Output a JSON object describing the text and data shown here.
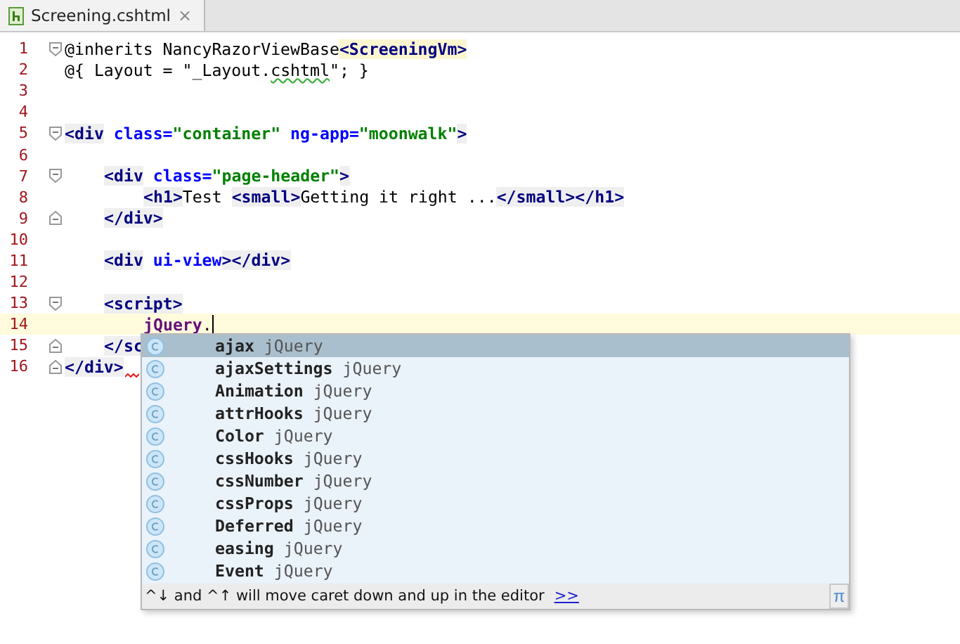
{
  "tabs": [
    {
      "label": "Screening.cshtml",
      "selected": true,
      "close": "×"
    }
  ],
  "lines": [
    {
      "number": "1",
      "kind": "top",
      "fold_start": true,
      "fold_end": false,
      "current": false,
      "error": false,
      "tokens": [
        {
          "kind": "plain",
          "text": "@inherits NancyRazorViewBase"
        },
        {
          "kind": "type",
          "text": "<ScreeningVm>"
        }
      ]
    },
    {
      "number": "2",
      "kind": "top",
      "fold_start": false,
      "fold_end": false,
      "current": false,
      "error": false,
      "tokens": [
        {
          "kind": "plain",
          "text": "@{ Layout = \"_Layout."
        },
        {
          "kind": "warn",
          "text": "cshtml"
        },
        {
          "kind": "plain",
          "text": "\"; }"
        }
      ]
    },
    {
      "number": "3",
      "fold_start": false,
      "fold_end": false,
      "current": false,
      "error": false
    },
    {
      "number": "4",
      "fold_start": false,
      "fold_end": false,
      "current": false,
      "error": false
    },
    {
      "number": "5",
      "kind": "top",
      "fold_start": true,
      "fold_end": false,
      "current": false,
      "error": false,
      "tokens": [
        {
          "kind": "tag",
          "text": "<div"
        },
        {
          "kind": "attr",
          "text": " class="
        },
        {
          "kind": "str",
          "text": "\"container\""
        },
        {
          "kind": "attr",
          "text": " ng-app="
        },
        {
          "kind": "str",
          "text": "\"moonwalk\""
        },
        {
          "kind": "tag",
          "text": ">"
        }
      ]
    },
    {
      "number": "6",
      "fold_start": false,
      "fold_end": false,
      "current": false,
      "error": false
    },
    {
      "number": "7",
      "kind": "inner",
      "fold_start": true,
      "fold_end": false,
      "current": false,
      "error": false,
      "tokens": [
        {
          "kind": "tag",
          "text": "<div"
        },
        {
          "kind": "attr",
          "text": " class="
        },
        {
          "kind": "str",
          "text": "\"page-header\""
        },
        {
          "kind": "tag",
          "text": ">"
        }
      ]
    },
    {
      "number": "8",
      "kind": "innermost",
      "fold_start": false,
      "fold_end": false,
      "current": false,
      "error": false,
      "tokens": [
        {
          "kind": "tag",
          "text": "<h1>"
        },
        {
          "kind": "plain",
          "text": "Test "
        },
        {
          "kind": "tag",
          "text": "<small>"
        },
        {
          "kind": "plain",
          "text": "Getting it right ..."
        },
        {
          "kind": "tag",
          "text": "</small></h1>"
        }
      ]
    },
    {
      "number": "9",
      "kind": "inner",
      "fold_start": false,
      "fold_end": true,
      "current": false,
      "error": false,
      "tokens": [
        {
          "kind": "tag",
          "text": "</div>"
        }
      ]
    },
    {
      "number": "10",
      "fold_start": false,
      "fold_end": false,
      "current": false,
      "error": false
    },
    {
      "number": "11",
      "kind": "inner",
      "fold_start": false,
      "fold_end": false,
      "current": false,
      "error": false,
      "tokens": [
        {
          "kind": "tag",
          "text": "<div"
        },
        {
          "kind": "attr",
          "text": " ui-view"
        },
        {
          "kind": "tag",
          "text": "></div>"
        }
      ]
    },
    {
      "number": "12",
      "fold_start": false,
      "fold_end": false,
      "current": false,
      "error": false
    },
    {
      "number": "13",
      "kind": "inner",
      "fold_start": true,
      "fold_end": false,
      "current": false,
      "error": false,
      "tokens": [
        {
          "kind": "tag",
          "text": "<script>"
        }
      ]
    },
    {
      "number": "14",
      "kind": "innermost",
      "fold_start": false,
      "fold_end": false,
      "current": true,
      "error": false,
      "tokens": [
        {
          "kind": "ident",
          "text": "jQuery"
        },
        {
          "kind": "plain",
          "text": "."
        }
      ]
    },
    {
      "number": "15",
      "kind": "inner",
      "fold_start": false,
      "fold_end": true,
      "current": false,
      "error": false,
      "tokens": [
        {
          "kind": "tag",
          "text": "</sc"
        }
      ]
    },
    {
      "number": "16",
      "kind": "top",
      "fold_start": false,
      "fold_end": true,
      "current": false,
      "error": true,
      "tokens": [
        {
          "kind": "tag",
          "text": "</div>"
        }
      ]
    }
  ],
  "completion": {
    "items": [
      {
        "name": "ajax",
        "type": "jQuery",
        "selected": true
      },
      {
        "name": "ajaxSettings",
        "type": "jQuery",
        "selected": false
      },
      {
        "name": "Animation",
        "type": "jQuery",
        "selected": false
      },
      {
        "name": "attrHooks",
        "type": "jQuery",
        "selected": false
      },
      {
        "name": "Color",
        "type": "jQuery",
        "selected": false
      },
      {
        "name": "cssHooks",
        "type": "jQuery",
        "selected": false
      },
      {
        "name": "cssNumber",
        "type": "jQuery",
        "selected": false
      },
      {
        "name": "cssProps",
        "type": "jQuery",
        "selected": false
      },
      {
        "name": "Deferred",
        "type": "jQuery",
        "selected": false
      },
      {
        "name": "easing",
        "type": "jQuery",
        "selected": false
      },
      {
        "name": "Event",
        "type": "jQuery",
        "selected": false
      }
    ],
    "hint": "^↓ and ^↑ will move caret down and up in the editor",
    "hint_link": ">>",
    "pi": "π"
  }
}
